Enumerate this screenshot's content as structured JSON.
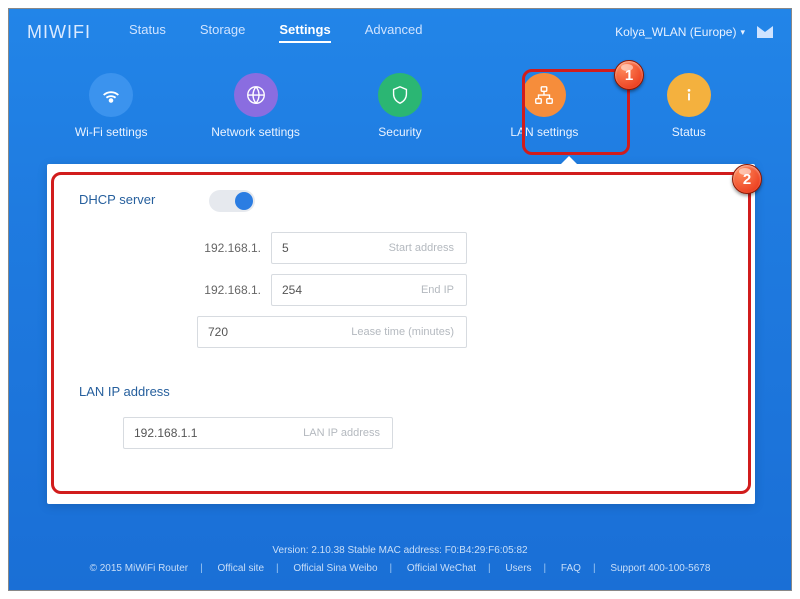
{
  "logo": "MIWIFI",
  "nav": {
    "status": "Status",
    "storage": "Storage",
    "settings": "Settings",
    "advanced": "Advanced"
  },
  "account": "Kolya_WLAN (Europe)",
  "subnav": {
    "wifi": "Wi-Fi settings",
    "network": "Network settings",
    "security": "Security",
    "lan": "LAN settings",
    "status": "Status"
  },
  "sections": {
    "dhcp": {
      "title": "DHCP server",
      "prefix": "192.168.1.",
      "start": "5",
      "start_hint": "Start address",
      "end": "254",
      "end_hint": "End IP",
      "lease": "720",
      "lease_hint": "Lease time (minutes)"
    },
    "lan": {
      "title": "LAN IP address",
      "ip": "192.168.1.1",
      "ip_hint": "LAN IP address"
    }
  },
  "footer": {
    "version_line": "Version: 2.10.38 Stable  MAC address: F0:B4:29:F6:05:82",
    "copyright": "© 2015 MiWiFi Router",
    "links": {
      "site": "Offical site",
      "weibo": "Official Sina Weibo",
      "wechat": "Official WeChat",
      "users": "Users",
      "faq": "FAQ",
      "support": "Support 400-100-5678"
    }
  },
  "badges": {
    "one": "1",
    "two": "2"
  }
}
